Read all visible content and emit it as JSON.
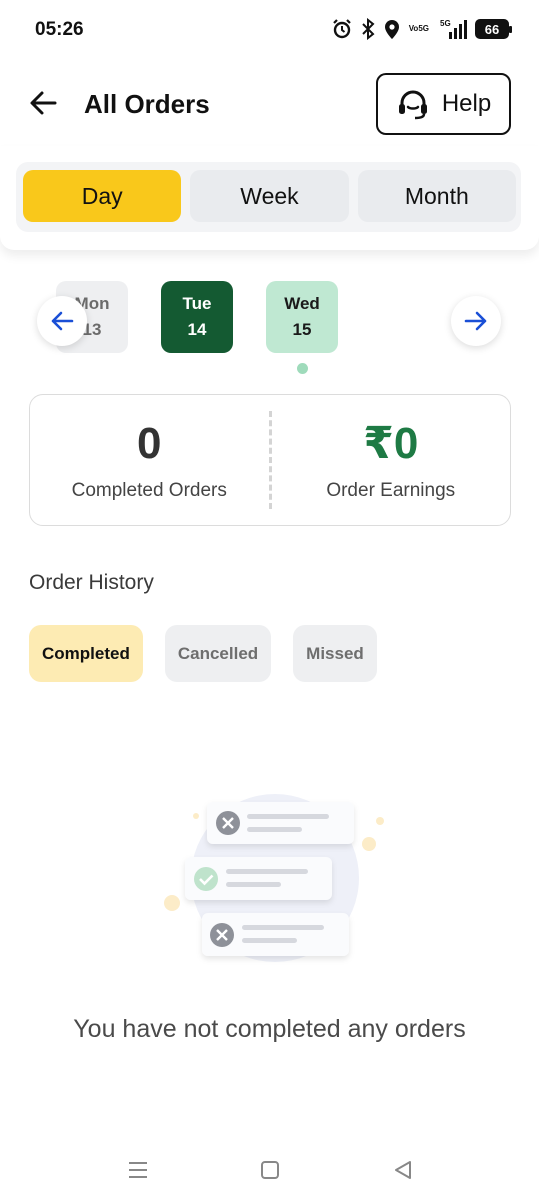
{
  "status_bar": {
    "time": "05:26",
    "battery": "66",
    "network": "5G",
    "volte": [
      "Vo",
      "5G"
    ]
  },
  "header": {
    "title": "All Orders",
    "help_label": "Help"
  },
  "period_tabs": [
    "Day",
    "Week",
    "Month"
  ],
  "period_selected": "Day",
  "dates": [
    {
      "day": "Mon",
      "date": "13"
    },
    {
      "day": "Tue",
      "date": "14"
    },
    {
      "day": "Wed",
      "date": "15"
    }
  ],
  "summary": {
    "completed_value": "0",
    "completed_label": "Completed Orders",
    "earnings_value": "₹0",
    "earnings_label": "Order Earnings"
  },
  "history": {
    "title": "Order History",
    "filters": [
      "Completed",
      "Cancelled",
      "Missed"
    ],
    "selected": "Completed"
  },
  "empty_message": "You have not completed any orders",
  "colors": {
    "accent_yellow": "#f9c81b",
    "selected_green": "#145a32",
    "today_green": "#bfe8d2",
    "earnings_green": "#1e7a44",
    "filter_active": "#fdebb3",
    "arrow_blue": "#1a4fd6"
  }
}
